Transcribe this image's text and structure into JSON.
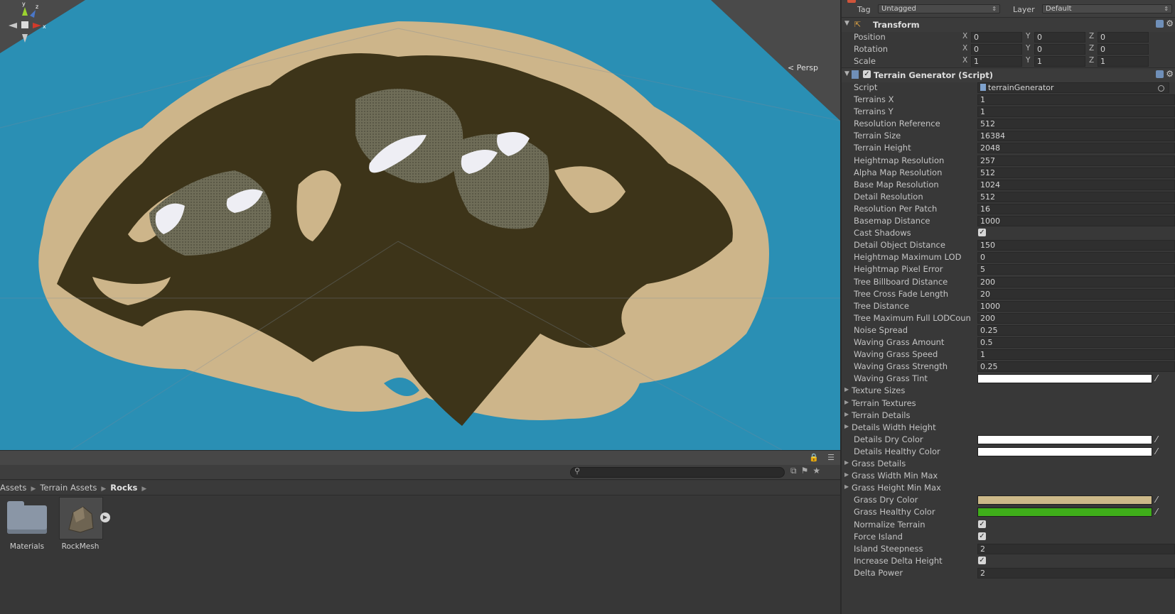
{
  "scene": {
    "projection_label": "Persp",
    "gizmo_axes": {
      "x": "x",
      "y": "y",
      "z": "z"
    }
  },
  "project": {
    "search": {
      "placeholder": ""
    },
    "breadcrumb": [
      "Assets",
      "Terrain Assets",
      "Rocks"
    ],
    "assets": [
      {
        "name": "Materials",
        "icon": "folder-icon"
      },
      {
        "name": "RockMesh",
        "icon": "mesh-icon"
      }
    ]
  },
  "inspector": {
    "tag_label": "Tag",
    "tag_value": "Untagged",
    "layer_label": "Layer",
    "layer_value": "Default",
    "transform": {
      "title": "Transform",
      "position": {
        "label": "Position",
        "x": "0",
        "y": "0",
        "z": "0"
      },
      "rotation": {
        "label": "Rotation",
        "x": "0",
        "y": "0",
        "z": "0"
      },
      "scale": {
        "label": "Scale",
        "x": "1",
        "y": "1",
        "z": "1"
      },
      "axis_labels": {
        "x": "X",
        "y": "Y",
        "z": "Z"
      }
    },
    "script_component": {
      "title": "Terrain Generator (Script)",
      "script_label": "Script",
      "script_value": "terrainGenerator",
      "fields": [
        {
          "label": "Terrains X",
          "value": "1"
        },
        {
          "label": "Terrains Y",
          "value": "1"
        },
        {
          "label": "Resolution Reference",
          "value": "512"
        },
        {
          "label": "Terrain Size",
          "value": "16384"
        },
        {
          "label": "Terrain Height",
          "value": "2048"
        },
        {
          "label": "Heightmap Resolution",
          "value": "257"
        },
        {
          "label": "Alpha Map Resolution",
          "value": "512"
        },
        {
          "label": "Base Map Resolution",
          "value": "1024"
        },
        {
          "label": "Detail Resolution",
          "value": "512"
        },
        {
          "label": "Resolution Per Patch",
          "value": "16"
        },
        {
          "label": "Basemap Distance",
          "value": "1000"
        },
        {
          "label": "Cast Shadows",
          "checkbox": true
        },
        {
          "label": "Detail Object Distance",
          "value": "150"
        },
        {
          "label": "Heightmap Maximum LOD",
          "value": "0"
        },
        {
          "label": "Heightmap Pixel Error",
          "value": "5"
        },
        {
          "label": "Tree Billboard Distance",
          "value": "200"
        },
        {
          "label": "Tree Cross Fade Length",
          "value": "20"
        },
        {
          "label": "Tree Distance",
          "value": "1000"
        },
        {
          "label": "Tree Maximum Full LODCoun",
          "value": "200"
        },
        {
          "label": "Noise Spread",
          "value": "0.25"
        },
        {
          "label": "Waving Grass Amount",
          "value": "0.5"
        },
        {
          "label": "Waving Grass Speed",
          "value": "1"
        },
        {
          "label": "Waving Grass Strength",
          "value": "0.25"
        },
        {
          "label": "Waving Grass Tint",
          "color": "#ffffff"
        },
        {
          "label": "Texture Sizes",
          "foldout": true
        },
        {
          "label": "Terrain Textures",
          "foldout": true
        },
        {
          "label": "Terrain Details",
          "foldout": true
        },
        {
          "label": "Details Width Height",
          "foldout": true
        },
        {
          "label": "Details Dry Color",
          "color": "#ffffff"
        },
        {
          "label": "Details Healthy Color",
          "color": "#ffffff"
        },
        {
          "label": "Grass Details",
          "foldout": true
        },
        {
          "label": "Grass Width Min Max",
          "foldout": true
        },
        {
          "label": "Grass Height Min Max",
          "foldout": true
        },
        {
          "label": "Grass Dry Color",
          "color": "#cdb989"
        },
        {
          "label": "Grass Healthy Color",
          "color": "#3fae1a"
        },
        {
          "label": "Normalize Terrain",
          "checkbox": true
        },
        {
          "label": "Force Island",
          "checkbox": true
        },
        {
          "label": "Island Steepness",
          "value": "2"
        },
        {
          "label": "Increase Delta Height",
          "checkbox": true
        },
        {
          "label": "Delta Power",
          "value": "2"
        }
      ]
    }
  },
  "colors": {
    "water": "#2a8fb4",
    "sand": "#cdb58a",
    "grass_dark": "#3d3419",
    "rock": "#6c6a55",
    "snow": "#eeeef4",
    "panel_bg": "#383838"
  }
}
